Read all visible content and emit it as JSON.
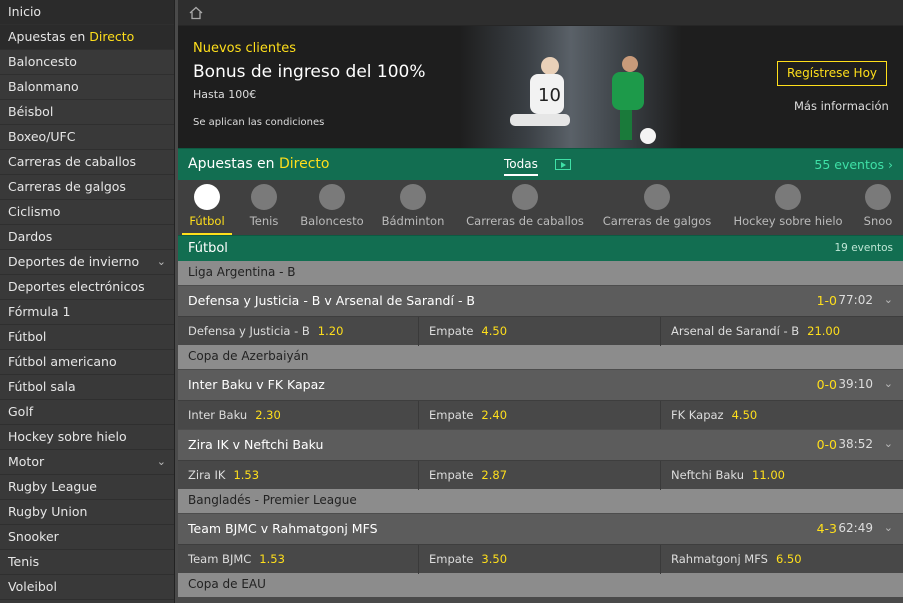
{
  "sidebar": {
    "items": [
      {
        "label": "Inicio"
      },
      {
        "label": "Apuestas en ",
        "highlight": "Directo"
      },
      {
        "label": "Baloncesto"
      },
      {
        "label": "Balonmano"
      },
      {
        "label": "Béisbol"
      },
      {
        "label": "Boxeo/UFC"
      },
      {
        "label": "Carreras de caballos"
      },
      {
        "label": "Carreras de galgos"
      },
      {
        "label": "Ciclismo"
      },
      {
        "label": "Dardos"
      },
      {
        "label": "Deportes de invierno",
        "expand": "⌄"
      },
      {
        "label": "Deportes electrónicos"
      },
      {
        "label": "Fórmula 1"
      },
      {
        "label": "Fútbol"
      },
      {
        "label": "Fútbol americano"
      },
      {
        "label": "Fútbol sala"
      },
      {
        "label": "Golf"
      },
      {
        "label": "Hockey sobre hielo"
      },
      {
        "label": "Motor",
        "expand": "⌄"
      },
      {
        "label": "Rugby League"
      },
      {
        "label": "Rugby Union"
      },
      {
        "label": "Snooker"
      },
      {
        "label": "Tenis"
      },
      {
        "label": "Voleibol"
      }
    ]
  },
  "banner": {
    "promo": "Nuevos clientes",
    "title": "Bonus de ingreso del 100%",
    "subtitle": "Hasta 100€",
    "conditions": "Se aplican las condiciones",
    "register_label": "Regístrese Hoy",
    "more_label": "Más información"
  },
  "live": {
    "title": "Apuestas en ",
    "title_highlight": "Directo",
    "tab": "Todas",
    "count": "55 eventos ›"
  },
  "sports": [
    {
      "label": "Fútbol",
      "icon": "football-icon",
      "active": true
    },
    {
      "label": "Tenis",
      "icon": "tennis-ball-icon"
    },
    {
      "label": "Baloncesto",
      "icon": "basketball-icon"
    },
    {
      "label": "Bádminton",
      "icon": "shuttlecock-icon"
    },
    {
      "label": "Carreras de caballos",
      "icon": "horse-racing-icon"
    },
    {
      "label": "Carreras de galgos",
      "icon": "greyhound-icon"
    },
    {
      "label": "Hockey sobre hielo",
      "icon": "hockey-puck-icon"
    },
    {
      "label": "Snoo",
      "icon": "snooker-icon"
    }
  ],
  "section": {
    "title": "Fútbol",
    "count": "19 eventos"
  },
  "groups": [
    {
      "league": "Liga Argentina - B",
      "events": [
        {
          "name": "Defensa y Justicia - B v Arsenal de Sarandí - B",
          "score": "1-0",
          "time": "77:02",
          "home": "Defensa y Justicia - B",
          "home_odds": "1.20",
          "draw": "Empate",
          "draw_odds": "4.50",
          "away": "Arsenal de Sarandí - B",
          "away_odds": "21.00"
        }
      ]
    },
    {
      "league": "Copa de Azerbaiyán",
      "events": [
        {
          "name": "Inter Baku v FK Kapaz",
          "score": "0-0",
          "time": "39:10",
          "home": "Inter Baku",
          "home_odds": "2.30",
          "draw": "Empate",
          "draw_odds": "2.40",
          "away": "FK Kapaz",
          "away_odds": "4.50"
        },
        {
          "name": "Zira IK v Neftchi Baku",
          "score": "0-0",
          "time": "38:52",
          "home": "Zira IK",
          "home_odds": "1.53",
          "draw": "Empate",
          "draw_odds": "2.87",
          "away": "Neftchi Baku",
          "away_odds": "11.00"
        }
      ]
    },
    {
      "league": "Bangladés - Premier League",
      "events": [
        {
          "name": "Team BJMC v Rahmatgonj MFS",
          "score": "4-3",
          "time": "62:49",
          "home": "Team BJMC",
          "home_odds": "1.53",
          "draw": "Empate",
          "draw_odds": "3.50",
          "away": "Rahmatgonj MFS",
          "away_odds": "6.50"
        }
      ]
    },
    {
      "league": "Copa de EAU",
      "events": []
    }
  ],
  "colors": {
    "accent": "#ffdf1b",
    "green": "#126e51",
    "teal": "#3fe0a6"
  }
}
